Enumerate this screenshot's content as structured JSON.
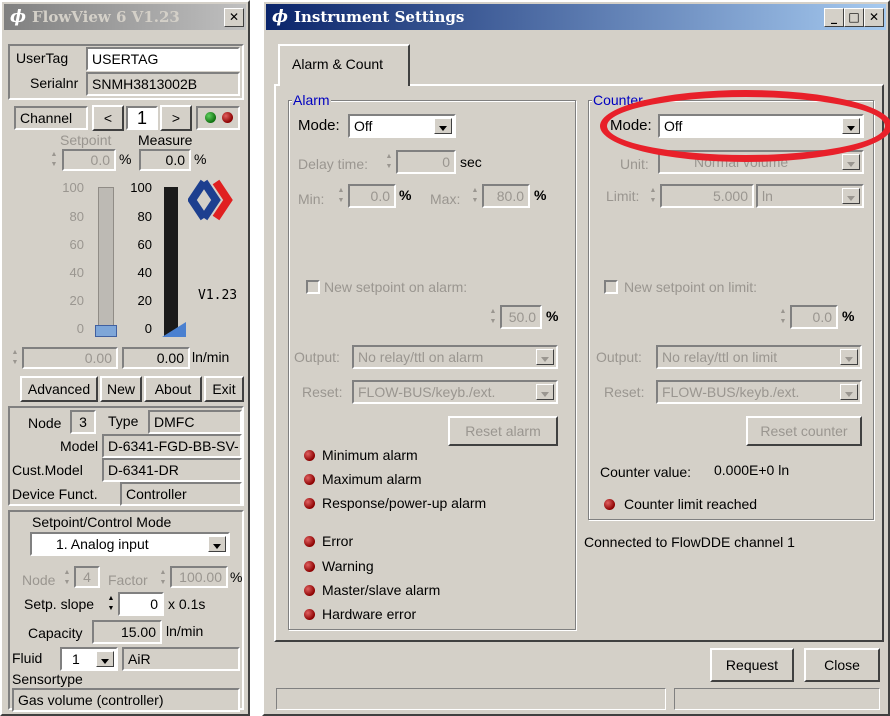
{
  "flowview": {
    "title": "FlowView 6 V1.23",
    "usertag_label": "UserTag",
    "usertag_value": "USERTAG",
    "serialnr_label": "Serialnr",
    "serialnr_value": "SNMH3813002B",
    "channel_label": "Channel",
    "prev": "<",
    "channel_value": "1",
    "next": ">",
    "setpoint_label": "Setpoint",
    "measure_label": "Measure",
    "setpoint_value": "0.0",
    "measure_value": "0.0",
    "percent": "%",
    "scale_left": [
      "100",
      "80",
      "60",
      "40",
      "20",
      "0"
    ],
    "scale_right": [
      "100",
      "80",
      "60",
      "40",
      "20",
      "0"
    ],
    "version": "V1.23",
    "flow_setpoint": "0.00",
    "flow_measure": "0.00",
    "flow_unit": "ln/min",
    "btn_advanced": "Advanced",
    "btn_new": "New",
    "btn_about": "About",
    "btn_exit": "Exit",
    "node_label": "Node",
    "node_value": "3",
    "type_label": "Type",
    "type_value": "DMFC",
    "model_label": "Model",
    "model_value": "D-6341-FGD-BB-SV-",
    "custmodel_label": "Cust.Model",
    "custmodel_value": "D-6341-DR",
    "devfunct_label": "Device Funct.",
    "devfunct_value": "Controller",
    "spmode_label": "Setpoint/Control Mode",
    "spmode_value": "1. Analog input",
    "node2_label": "Node",
    "node2_value": "4",
    "factor_label": "Factor",
    "factor_value": "100.00",
    "setp_slope_label": "Setp. slope",
    "setp_slope_value": "0",
    "setp_slope_unit": "x 0.1s",
    "capacity_label": "Capacity",
    "capacity_value": "15.00",
    "capacity_unit": "ln/min",
    "fluid_label": "Fluid",
    "fluid_value": "1",
    "fluid_name": "AiR",
    "sensortype_label": "Sensortype",
    "sensortype_value": "Gas volume (controller)"
  },
  "settings": {
    "title": "Instrument Settings",
    "tab": "Alarm & Count",
    "alarm": {
      "legend": "Alarm",
      "mode_label": "Mode:",
      "mode_value": "Off",
      "delay_label": "Delay time:",
      "delay_value": "0",
      "delay_unit": "sec",
      "min_label": "Min:",
      "min_value": "0.0",
      "max_label": "Max:",
      "max_value": "80.0",
      "percent": "%",
      "new_setpoint_label": "New setpoint on alarm:",
      "new_setpoint_value": "50.0",
      "output_label": "Output:",
      "output_value": "No relay/ttl on alarm",
      "reset_label": "Reset:",
      "reset_value": "FLOW-BUS/keyb./ext.",
      "reset_button": "Reset alarm",
      "indicators": [
        "Minimum alarm",
        "Maximum alarm",
        "Response/power-up alarm",
        "Error",
        "Warning",
        "Master/slave alarm",
        "Hardware error"
      ]
    },
    "counter": {
      "legend": "Counter",
      "mode_label": "Mode:",
      "mode_value": "Off",
      "unit_label": "Unit:",
      "unit_value": "Normal volume",
      "limit_label": "Limit:",
      "limit_value": "5.000",
      "limit_unit": "ln",
      "new_setpoint_label": "New setpoint on limit:",
      "new_setpoint_value": "0.0",
      "percent": "%",
      "output_label": "Output:",
      "output_value": "No relay/ttl on limit",
      "reset_label": "Reset:",
      "reset_value": "FLOW-BUS/keyb./ext.",
      "reset_button": "Reset counter",
      "counter_value_label": "Counter value:",
      "counter_value": "0.000E+0 ln",
      "limit_reached": "Counter limit reached"
    },
    "connected": "Connected to FlowDDE channel 1",
    "request": "Request",
    "close": "Close"
  },
  "colors": {
    "titlebar": "#0a246a",
    "led_red": "#8b0000",
    "legend_blue": "#0000c0",
    "highlight_ellipse": "#e8202a",
    "brand_blue": "#1d3f8f",
    "brand_red": "#e02020"
  }
}
